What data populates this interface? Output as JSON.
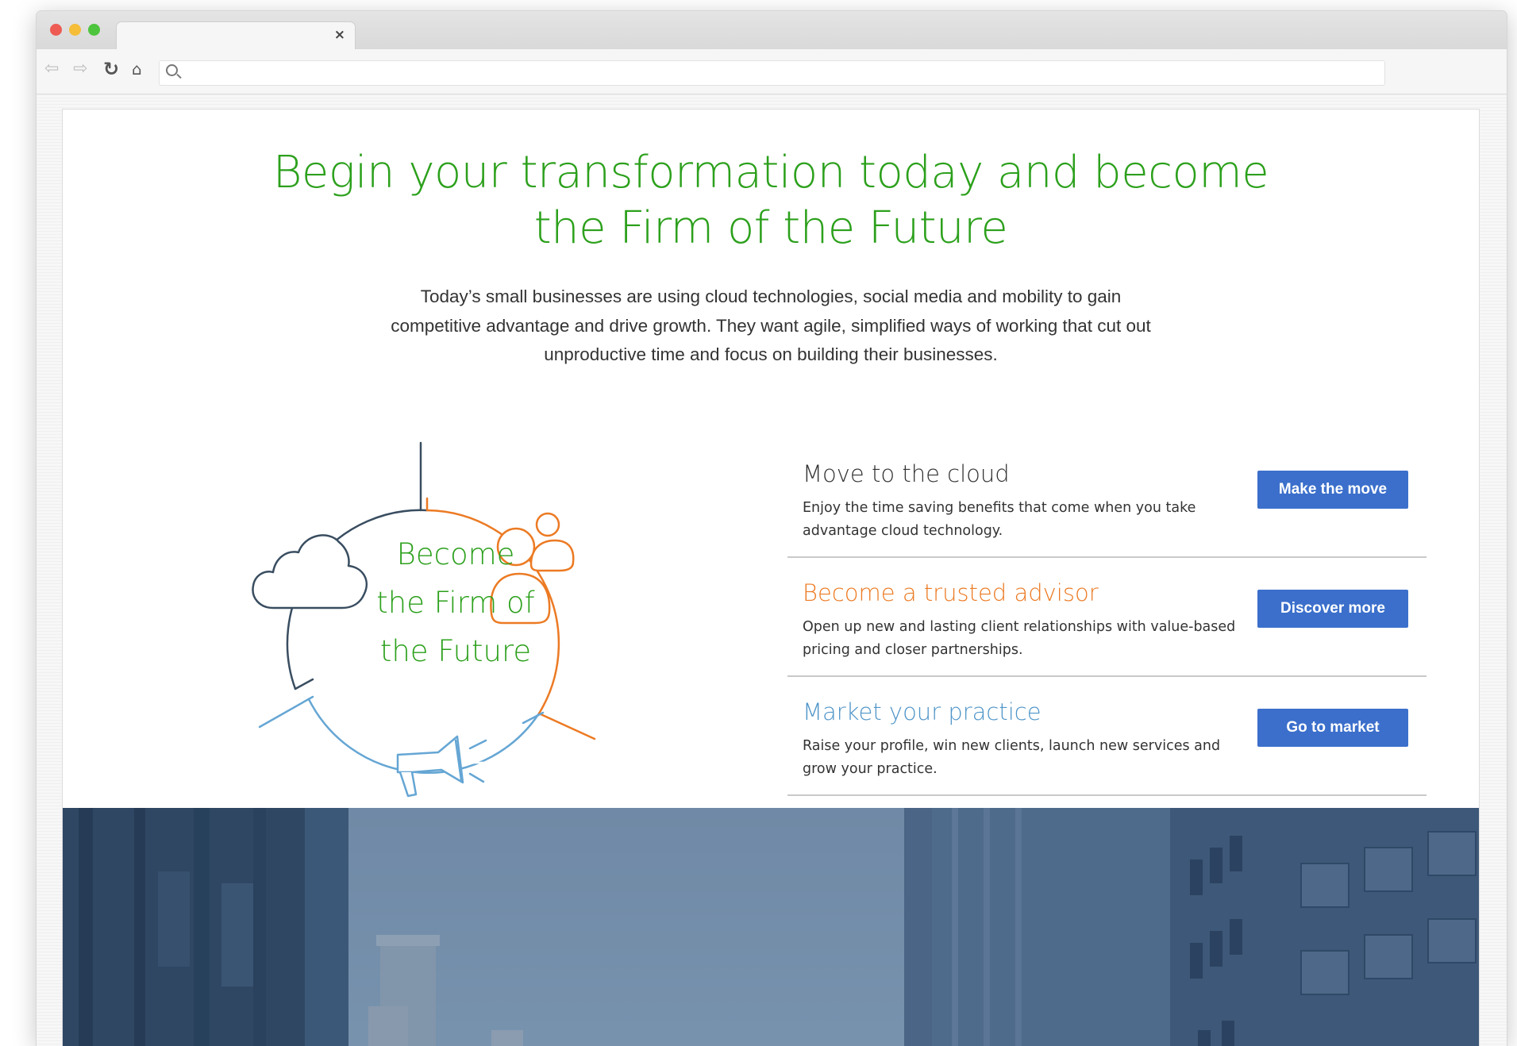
{
  "browser": {
    "tab_close": "×",
    "icons": [
      "back-arrow-icon",
      "forward-arrow-icon",
      "reload-icon",
      "home-icon",
      "search-icon"
    ]
  },
  "hero_section": {
    "headline_line1": "Begin your transformation today and become",
    "headline_line2": "the Firm of the Future",
    "intro_line1": "Today’s small businesses are using cloud technologies, social media and mobility to gain",
    "intro_line2": "competitive advantage and drive growth. They want agile, simplified ways of working that cut out",
    "intro_line3": "unproductive time and focus on building their businesses."
  },
  "illustration": {
    "line1": "Become",
    "line2": "the Firm of",
    "line3": "the Future",
    "icons": [
      "cloud-icon",
      "advisor-people-icon",
      "megaphone-icon"
    ],
    "colors": {
      "dark": "#394d60",
      "orange": "#ec7a23",
      "blue": "#65a6d4",
      "green": "#2ca01c"
    }
  },
  "features": [
    {
      "title": "Move to the cloud",
      "desc_line1": "Enjoy the time saving benefits that come when you take",
      "desc_line2": "advantage cloud technology.",
      "button": "Make the move",
      "title_color": "#333333"
    },
    {
      "title": "Become a trusted advisor",
      "desc_line1": "Open up new and lasting client relationships with value-based",
      "desc_line2": "pricing and closer partnerships.",
      "button": "Discover more",
      "title_color": "#ec7a23"
    },
    {
      "title": "Market your practice",
      "desc_line1": "Raise your profile, win new clients, launch new services and",
      "desc_line2": "grow your practice.",
      "button": "Go to market",
      "title_color": "#4f95c8"
    }
  ],
  "colors": {
    "accent_green": "#2ca01c",
    "button_blue": "#3b6fcb"
  }
}
